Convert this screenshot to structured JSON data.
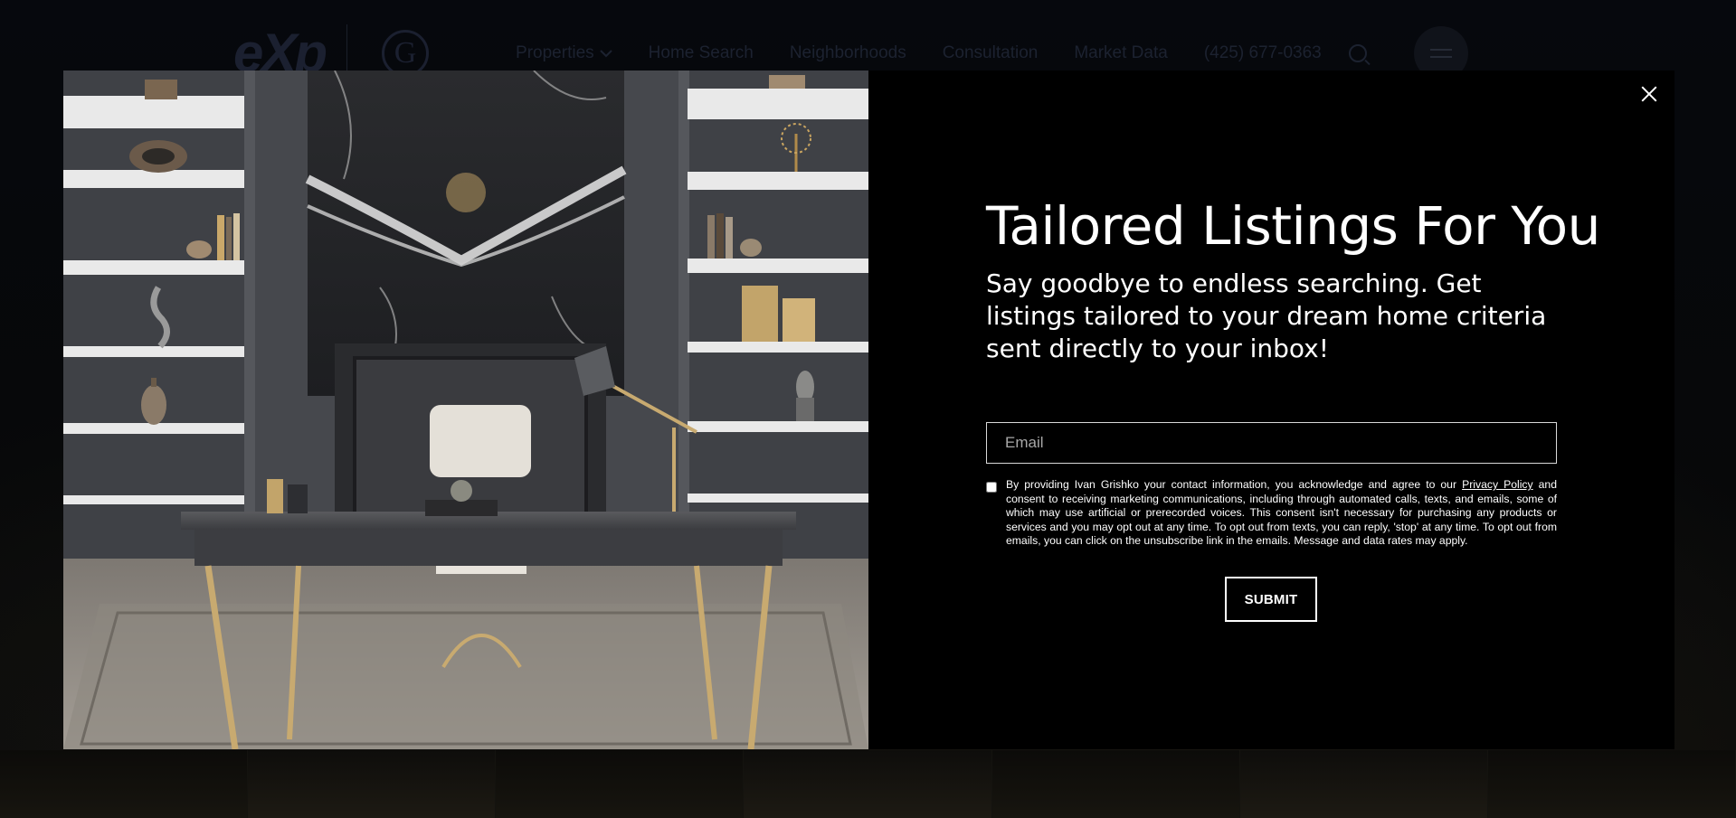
{
  "header": {
    "logo_primary": "eXp",
    "logo_secondary": "G",
    "nav": [
      {
        "label": "Properties"
      },
      {
        "label": "Home Search"
      },
      {
        "label": "Neighborhoods"
      },
      {
        "label": "Consultation"
      },
      {
        "label": "Market Data"
      },
      {
        "label": "(425) 677-0363"
      }
    ]
  },
  "modal": {
    "title": "Tailored Listings For You",
    "subtitle": "Say goodbye to endless searching. Get listings tailored to your dream home criteria sent directly to your inbox!",
    "email_placeholder": "Email",
    "email_value": "",
    "consent_checked": false,
    "consent_before": "By providing Ivan Grishko your contact information, you acknowledge and agree to our",
    "privacy_link": "Privacy Policy",
    "consent_after": "and consent to receiving marketing communications, including through automated calls, texts, and emails, some of which may use artificial or prerecorded voices. This consent isn't necessary for purchasing any products or services and you may opt out at any time. To opt out from texts, you can reply, 'stop' at any time. To opt out from emails, you can click on the unsubscribe link in the emails. Message and data rates may apply.",
    "submit_label": "SUBMIT"
  },
  "colors": {
    "modal_background": "#000000",
    "overlay": "#05070b",
    "text": "#ffffff"
  }
}
